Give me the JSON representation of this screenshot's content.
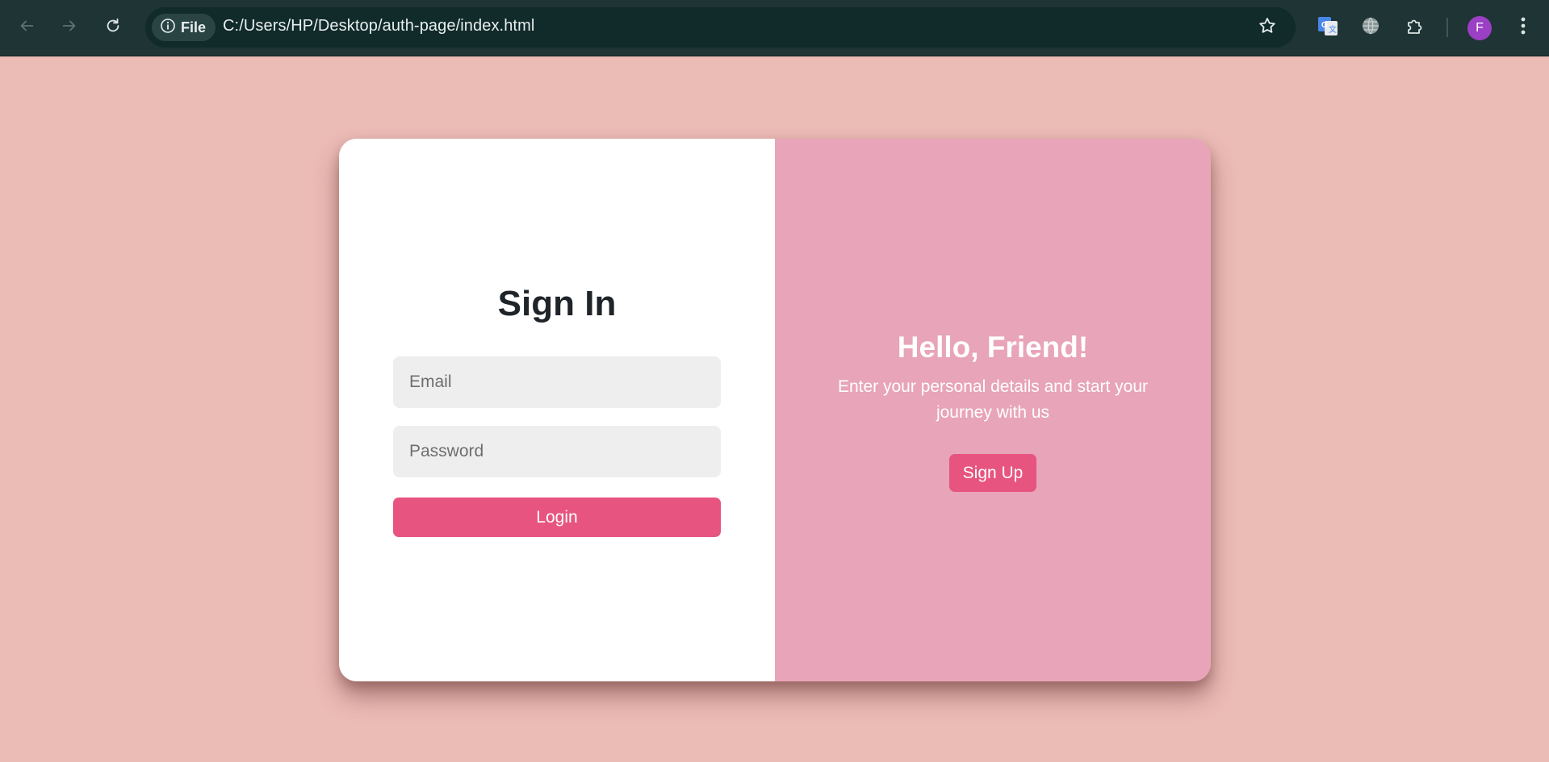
{
  "browser": {
    "site_chip_label": "File",
    "url": "C:/Users/HP/Desktop/auth-page/index.html",
    "profile_initial": "F",
    "icons": {
      "back": "arrow-left-icon",
      "forward": "arrow-right-icon",
      "reload": "reload-icon",
      "site_info": "info-icon",
      "bookmark": "star-icon",
      "translate": "google-translate-icon",
      "globe": "globe-icon",
      "extensions": "puzzle-icon",
      "menu": "kebab-menu-icon"
    }
  },
  "signin": {
    "title": "Sign In",
    "email_placeholder": "Email",
    "password_placeholder": "Password",
    "login_label": "Login"
  },
  "welcome": {
    "title": "Hello, Friend!",
    "text": "Enter your personal details and start your journey with us",
    "signup_label": "Sign Up"
  },
  "colors": {
    "page_background": "#ebbbb5",
    "accent": "#e75480",
    "panel_pink": "#e8a4b9",
    "browser_chrome": "#1f3434"
  }
}
